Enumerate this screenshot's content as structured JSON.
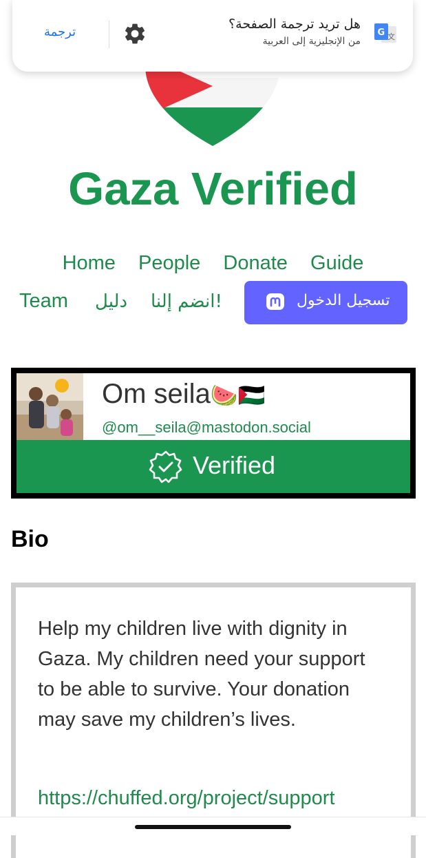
{
  "translate_bar": {
    "question": "هل تريد ترجمة الصفحة؟",
    "subtitle": "من الإنجليزية إلى العربية",
    "translate_button": "ترجمة"
  },
  "site": {
    "title": "Gaza Verified",
    "accent_color": "#1a9650"
  },
  "nav": {
    "home": "Home",
    "people": "People",
    "donate": "Donate",
    "guide": "Guide",
    "team": "Team",
    "guide_ar": "دليل",
    "join_ar": "انضم إلنا!",
    "login": "تسجيل الدخول",
    "login_color": "#6364ff"
  },
  "profile": {
    "name": "Om seila",
    "name_emoji": "🍉🇵🇸",
    "handle": "@om__seila@mastodon.social",
    "status": "Verified"
  },
  "bio": {
    "heading": "Bio",
    "text": "Help my children live with dignity in Gaza. My children need your support to be able to survive. Your donation may save my children’s lives.",
    "link": "https://chuffed.org/project/support"
  }
}
